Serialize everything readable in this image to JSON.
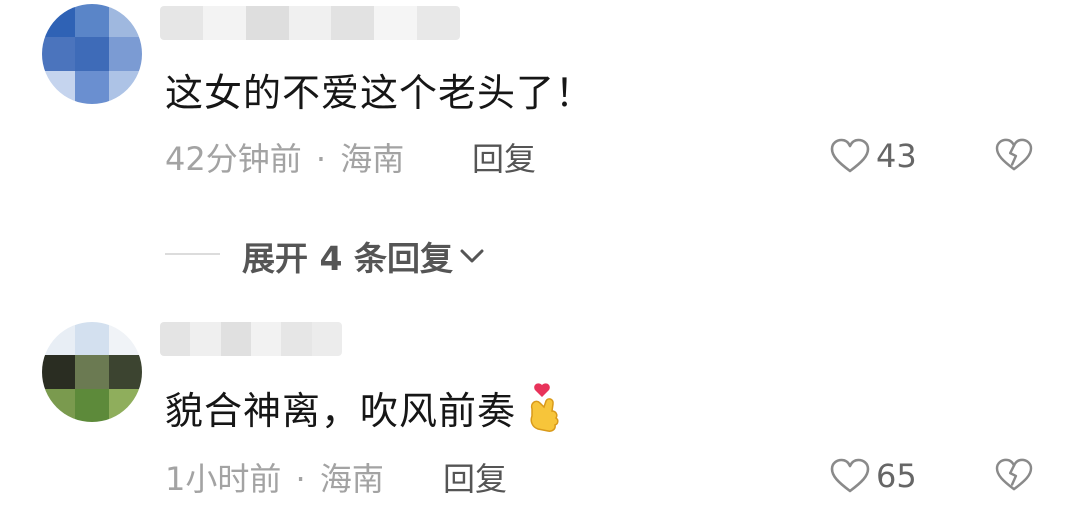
{
  "comments": [
    {
      "text": "这女的不爱这个老头了！",
      "time": "42分钟前",
      "separator": "·",
      "location": "海南",
      "reply_label": "回复",
      "likes": "43",
      "avatar_colors": [
        "#2f62b5",
        "#5a85c8",
        "#9fb8df",
        "#4b74bd",
        "#3e6bb8",
        "#7b9bd3",
        "#c5d4ee",
        "#6a8fd0",
        "#adc3e6"
      ],
      "name_blur_colors": [
        "#e6e6e6",
        "#f3f3f3",
        "#dedede",
        "#f0f0f0",
        "#e2e2e2",
        "#f5f5f5",
        "#e8e8e8"
      ]
    },
    {
      "text": "貌合神离，吹风前奏",
      "emoji": "🫰",
      "time": "1小时前",
      "separator": "·",
      "location": "海南",
      "reply_label": "回复",
      "likes": "65",
      "avatar_colors": [
        "#e8eef5",
        "#d3e0ef",
        "#f0f3f7",
        "#2a2d22",
        "#6b7a52",
        "#3c4430",
        "#7a9a4e",
        "#5d8a3a",
        "#8fae5c"
      ],
      "name_blur_colors": [
        "#e4e4e4",
        "#efefef",
        "#e0e0e0",
        "#f2f2f2",
        "#e6e6e6",
        "#ececec"
      ]
    }
  ],
  "expand": {
    "label": "展开 4 条回复"
  },
  "colors": {
    "text": "#161616",
    "meta": "#a3a3a3",
    "reply": "#555555"
  },
  "icons": {
    "like": "heart-outline-icon",
    "dislike": "broken-heart-icon",
    "expand": "chevron-down-icon"
  }
}
